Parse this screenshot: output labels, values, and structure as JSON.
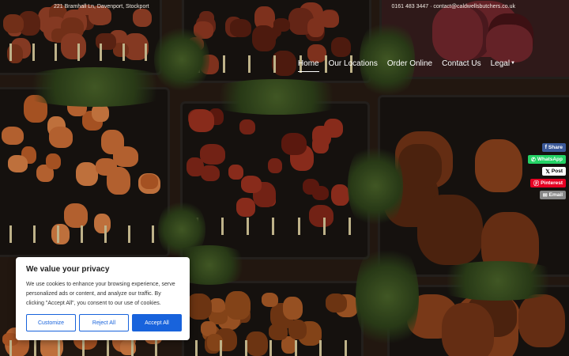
{
  "topbar": {
    "address": "221 Bramhall Ln, Davenport, Stockport",
    "contact": "0161 483 3447 · contact@caldwellsbutchers.co.uk"
  },
  "nav": {
    "items": [
      {
        "label": "Home",
        "active": true
      },
      {
        "label": "Our Locations"
      },
      {
        "label": "Order Online"
      },
      {
        "label": "Contact Us"
      },
      {
        "label": "Legal",
        "dropdown": true
      }
    ]
  },
  "share": [
    {
      "label": "Share",
      "icon": "facebook-icon",
      "color": "#3b5998"
    },
    {
      "label": "WhatsApp",
      "icon": "whatsapp-icon",
      "color": "#25d366"
    },
    {
      "label": "Post",
      "icon": "x-icon",
      "color": "#ffffff"
    },
    {
      "label": "Pinterest",
      "icon": "pinterest-icon",
      "color": "#e60023"
    },
    {
      "label": "Email",
      "icon": "email-icon",
      "color": "#888888"
    }
  ],
  "cookie": {
    "title": "We value your privacy",
    "body": "We use cookies to enhance your browsing experience, serve personalized ads or content, and analyze our traffic. By clicking \"Accept All\", you consent to our use of cookies.",
    "customize": "Customize",
    "reject": "Reject All",
    "accept": "Accept All",
    "accent": "#1863dc"
  }
}
